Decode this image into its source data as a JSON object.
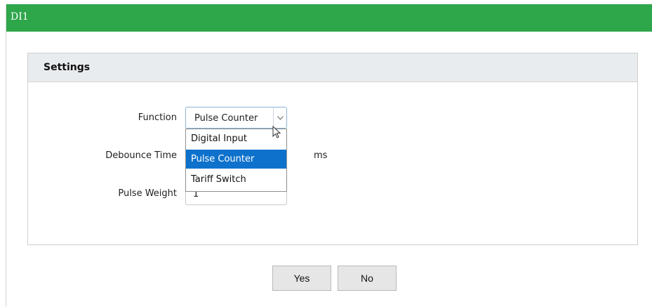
{
  "window": {
    "title": "DI1"
  },
  "panel": {
    "title": "Settings"
  },
  "form": {
    "function": {
      "label": "Function",
      "value": "Pulse Counter",
      "options": [
        "Digital Input",
        "Pulse Counter",
        "Tariff Switch"
      ],
      "selected_index": 1
    },
    "debounce_time": {
      "label": "Debounce Time",
      "unit": "ms"
    },
    "pulse_weight": {
      "label": "Pulse Weight",
      "value": "1"
    }
  },
  "buttons": {
    "yes": "Yes",
    "no": "No"
  },
  "colors": {
    "titlebar": "#2ea64a",
    "selection": "#0e72cc",
    "panel_header": "#e8ecee"
  }
}
